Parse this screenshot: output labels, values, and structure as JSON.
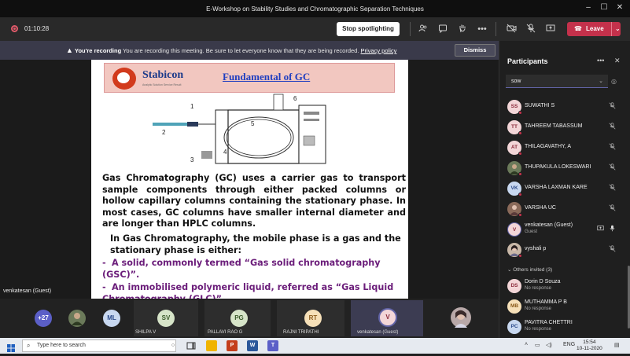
{
  "window": {
    "title": "E-Workshop on Stability Studies and Chromatographic Separation Techniques",
    "min": "–",
    "max": "☐",
    "close": "✕"
  },
  "meeting": {
    "timer": "01:10:28",
    "spotlight_button": "Stop spotlighting",
    "leave_label": "Leave",
    "leave_phone": "☎",
    "leave_dropdown": "⌄"
  },
  "recording_notice": {
    "icon": "▲",
    "bold": "You're recording",
    "text": " You are recording this meeting. Be sure to let everyone know that they are being recorded. ",
    "link": "Privacy policy",
    "dismiss": "Dismiss"
  },
  "slide": {
    "logo_name": "Stabicon",
    "logo_tag": "Analytic Solution Service Result",
    "title": "Fundamental of GC",
    "diagram_labels": [
      "1",
      "2",
      "3",
      "4",
      "5",
      "6"
    ],
    "paragraph1": "Gas Chromatography (GC) uses a carrier gas to transport sample components through either packed columns or hollow capillary columns containing the stationary phase. In most cases, GC columns have smaller internal diameter and are longer than HPLC columns.",
    "paragraph2": "In Gas Chromatography, the mobile phase is a gas and the stationary phase is either:",
    "bullets": [
      "A solid, commonly termed “Gas solid chromatography (GSC)”.",
      "An immobilised polymeric liquid, referred as “Gas Liquid Chromatography (GLC)”."
    ],
    "bullet_marker": "-"
  },
  "speaker": "venkatesan (Guest)",
  "thumbnails": [
    {
      "initials": "+27",
      "name": "",
      "color": "#5b5fc7",
      "fg": "#ffffff"
    },
    {
      "initials": "",
      "name": "",
      "color": "#6b7a5a",
      "fg": "#ffffff"
    },
    {
      "initials": "ML",
      "name": "",
      "color": "#c8d8f0",
      "fg": "#2b4a8a"
    },
    {
      "initials": "SV",
      "name": "SHILPA V",
      "color": "#d6e4c8",
      "fg": "#3a5a2a"
    },
    {
      "initials": "PG",
      "name": "PALLAVI RAO G",
      "color": "#d6e4c8",
      "fg": "#3a5a2a"
    },
    {
      "initials": "RT",
      "name": "RAJNI TRIPATHI",
      "color": "#f6e0b8",
      "fg": "#8a5a1a"
    },
    {
      "initials": "V",
      "name": "venkatesan (Guest)",
      "color": "#f3d6d8",
      "fg": "#8a2a3a"
    },
    {
      "initials": "",
      "name": "",
      "color": "#9a8a8a",
      "fg": "#ffffff"
    }
  ],
  "participants_panel": {
    "title": "Participants",
    "more": "•••",
    "close": "✕",
    "search_value": "sow",
    "chevron": "⌄",
    "eye": "◎",
    "people": [
      {
        "initials": "SS",
        "name": "SUWATHI S",
        "sub": "",
        "bg": "#f3d6d8",
        "fg": "#8a2a3a",
        "mic": "🎤"
      },
      {
        "initials": "TT",
        "name": "TAHREEM TABASSUM",
        "sub": "",
        "bg": "#f3d6d8",
        "fg": "#8a2a3a",
        "mic": "🎤"
      },
      {
        "initials": "AT",
        "name": "THILAGAVATHY, A",
        "sub": "",
        "bg": "#f3d6d8",
        "fg": "#8a2a3a",
        "mic": "🎤"
      },
      {
        "initials": "",
        "name": "THUPAKULA LOKESWARI",
        "sub": "",
        "bg": "#6b7a5a",
        "fg": "#ffffff",
        "mic": "🎤"
      },
      {
        "initials": "VK",
        "name": "VARSHA LAXMAN KARE",
        "sub": "",
        "bg": "#c8d8f0",
        "fg": "#2b4a8a",
        "mic": "🎤"
      },
      {
        "initials": "",
        "name": "VARSHA UC",
        "sub": "",
        "bg": "#8a6a5a",
        "fg": "#ffffff",
        "mic": "🎤"
      },
      {
        "initials": "V",
        "name": "venkatesan (Guest)",
        "sub": "Guest",
        "bg": "#f3d6d8",
        "fg": "#8a2a3a",
        "mic": "🎤"
      },
      {
        "initials": "",
        "name": "vyshali p",
        "sub": "",
        "bg": "#c9b8a8",
        "fg": "#ffffff",
        "mic": "🎤"
      }
    ],
    "others_header": "Others invited (3)",
    "invited": [
      {
        "initials": "DS",
        "name": "Dorin D Souza",
        "sub": "No response",
        "bg": "#f3d6d8",
        "fg": "#8a2a3a"
      },
      {
        "initials": "MB",
        "name": "MUTHAMMA P B",
        "sub": "No response",
        "bg": "#f6e0b8",
        "fg": "#8a5a1a"
      },
      {
        "initials": "PC",
        "name": "PAVITRA CHETTRI",
        "sub": "No response",
        "bg": "#c8d8f0",
        "fg": "#2b4a8a"
      }
    ]
  },
  "taskbar": {
    "search_placeholder": "Type here to search",
    "search_icon": "⌕",
    "lang": "ENG",
    "time": "15:54",
    "date": "10-11-2020",
    "tray_up": "˄",
    "tray_speaker": "◁)",
    "tray_net": "▭"
  }
}
